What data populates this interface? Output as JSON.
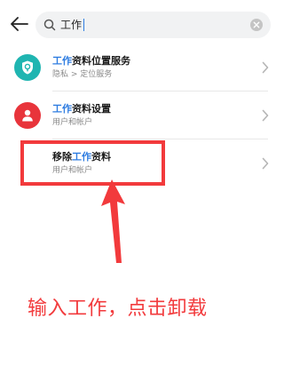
{
  "search": {
    "query": "工作",
    "icon": "search-icon",
    "clear_icon": "clear-icon"
  },
  "results": [
    {
      "title_highlight": "工作",
      "title_rest": "资料位置服务",
      "subtitle": "隐私 > 定位服务",
      "icon": "shield-location-icon",
      "icon_color": "#1fb5b1"
    },
    {
      "title_highlight": "工作",
      "title_rest": "资料设置",
      "subtitle": "用户和帐户",
      "icon": "person-icon",
      "icon_color": "#e8343b"
    },
    {
      "title_prefix": "移除",
      "title_highlight": "工作",
      "title_rest": "资料",
      "subtitle": "用户和帐户"
    }
  ],
  "annotation": {
    "text": "输入工作，点击卸载",
    "color": "#f23a3c"
  },
  "colors": {
    "highlight": "#2f7de1",
    "search_bg": "#f1f2f3"
  }
}
